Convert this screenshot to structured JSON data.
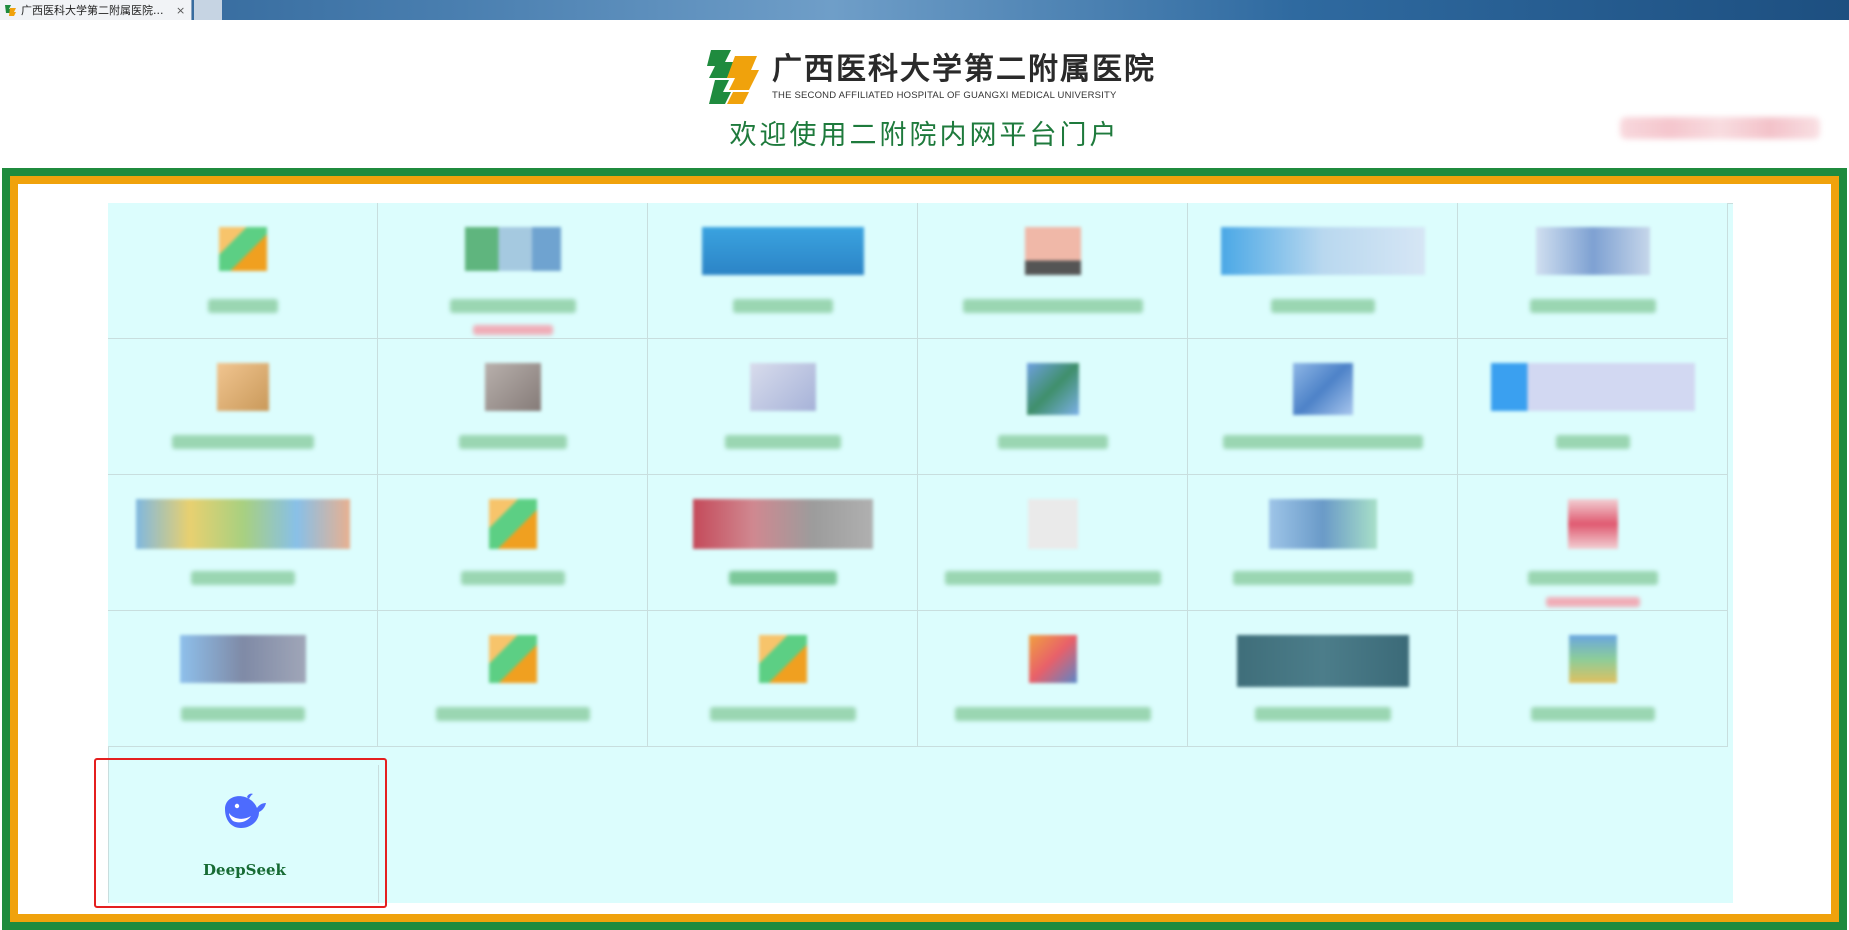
{
  "browser": {
    "tab_title": "广西医科大学第二附属医院...",
    "tab_close": "×"
  },
  "header": {
    "logo_cn": "广西医科大学第二附属医院",
    "logo_en": "THE SECOND AFFILIATED HOSPITAL OF GUANGXI MEDICAL UNIVERSITY",
    "welcome": "欢迎使用二附院内网平台门户"
  },
  "colors": {
    "frame_green": "#1f8b3e",
    "frame_orange": "#f0a20c",
    "tile_bg": "#dcfdfd",
    "highlight_red": "#e41f1f",
    "deepseek_blue": "#4d6bfe"
  },
  "featured_app": {
    "label": "DeepSeek",
    "icon": "whale-icon",
    "highlighted": true
  }
}
